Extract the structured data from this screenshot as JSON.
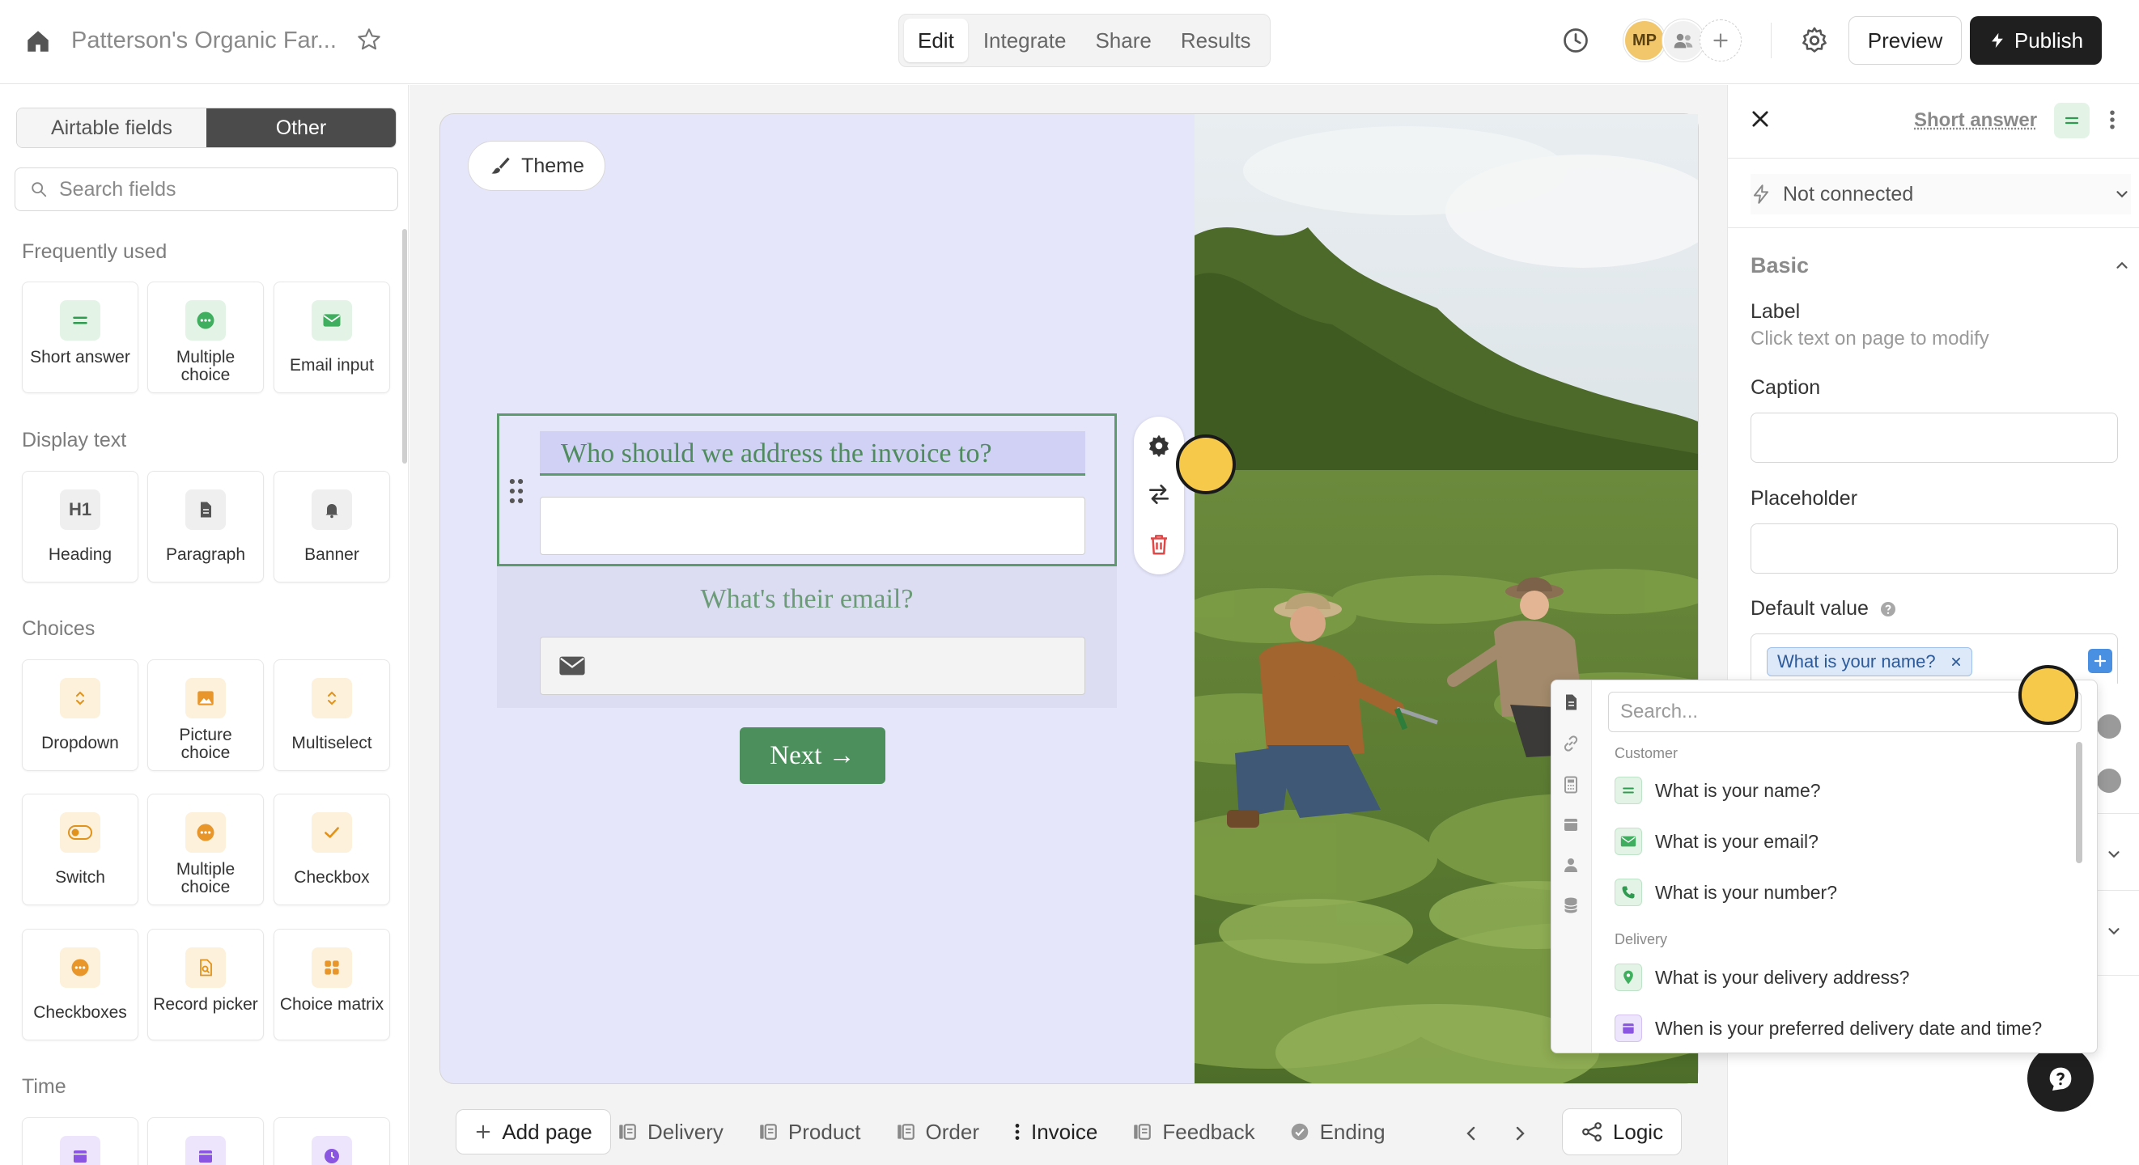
{
  "topbar": {
    "title": "Patterson's Organic Far...",
    "tabs": [
      {
        "label": "Edit",
        "active": true
      },
      {
        "label": "Integrate",
        "active": false
      },
      {
        "label": "Share",
        "active": false
      },
      {
        "label": "Results",
        "active": false
      }
    ],
    "avatar_initials": "MP",
    "preview_label": "Preview",
    "publish_label": "Publish"
  },
  "left": {
    "tabs": [
      "Airtable fields",
      "Other"
    ],
    "active_tab": "Other",
    "search_placeholder": "Search fields",
    "sections": [
      {
        "title": "Frequently used",
        "items": [
          {
            "label": "Short answer",
            "icon": "equals-icon",
            "color": "green"
          },
          {
            "label": "Multiple choice",
            "icon": "dots-circle-icon",
            "color": "green"
          },
          {
            "label": "Email input",
            "icon": "envelope-icon",
            "color": "green"
          }
        ]
      },
      {
        "title": "Display text",
        "items": [
          {
            "label": "Heading",
            "icon": "h1-icon",
            "color": "gray"
          },
          {
            "label": "Paragraph",
            "icon": "document-icon",
            "color": "gray"
          },
          {
            "label": "Banner",
            "icon": "bell-icon",
            "color": "gray"
          }
        ]
      },
      {
        "title": "Choices",
        "items": [
          {
            "label": "Dropdown",
            "icon": "chevron-updown-icon",
            "color": "orange"
          },
          {
            "label": "Picture choice",
            "icon": "image-icon",
            "color": "orange"
          },
          {
            "label": "Multiselect",
            "icon": "chevron-updown-icon",
            "color": "orange"
          },
          {
            "label": "Switch",
            "icon": "toggle-icon",
            "color": "orange"
          },
          {
            "label": "Multiple choice",
            "icon": "dots-circle-icon",
            "color": "orange"
          },
          {
            "label": "Checkbox",
            "icon": "check-icon",
            "color": "orange"
          },
          {
            "label": "Checkboxes",
            "icon": "dots-circle-icon",
            "color": "orange"
          },
          {
            "label": "Record picker",
            "icon": "record-search-icon",
            "color": "orange"
          },
          {
            "label": "Choice matrix",
            "icon": "grid-icon",
            "color": "orange"
          }
        ]
      },
      {
        "title": "Time",
        "items": [
          {
            "label": "",
            "icon": "calendar-icon",
            "color": "purple"
          },
          {
            "label": "",
            "icon": "calendar-icon",
            "color": "purple"
          },
          {
            "label": "",
            "icon": "clock-icon",
            "color": "purple"
          }
        ]
      }
    ]
  },
  "canvas": {
    "theme_label": "Theme",
    "question1": "Who should we address the invoice to?",
    "question2": "What's their email?",
    "next_label": "Next →",
    "colors": {
      "background": "#e6e6fb",
      "accent": "#4d8e5d"
    }
  },
  "pages": {
    "add_label": "Add page",
    "items": [
      {
        "label": "Delivery",
        "active": false
      },
      {
        "label": "Product",
        "active": false
      },
      {
        "label": "Order",
        "active": false
      },
      {
        "label": "Invoice",
        "active": true
      },
      {
        "label": "Feedback",
        "active": false
      },
      {
        "label": "Ending",
        "active": false
      }
    ],
    "logic_label": "Logic"
  },
  "right": {
    "field_type": "Short answer",
    "connection": "Not connected",
    "section": "Basic",
    "label_title": "Label",
    "label_hint": "Click text on page to modify",
    "caption_title": "Caption",
    "caption_value": "",
    "placeholder_title": "Placeholder",
    "placeholder_value": "",
    "default_title": "Default value",
    "default_chip": "What is your name?"
  },
  "popup": {
    "search_placeholder": "Search...",
    "groups": [
      {
        "title": "Customer",
        "items": [
          {
            "label": "What is your name?",
            "icon": "equals-icon",
            "color": "green"
          },
          {
            "label": "What is your email?",
            "icon": "envelope-icon",
            "color": "green"
          },
          {
            "label": "What is your number?",
            "icon": "phone-icon",
            "color": "green"
          }
        ]
      },
      {
        "title": "Delivery",
        "items": [
          {
            "label": "What is your delivery address?",
            "icon": "pin-icon",
            "color": "green"
          },
          {
            "label": "When is your preferred delivery date and time?",
            "icon": "calendar-icon",
            "color": "purple"
          }
        ]
      }
    ]
  }
}
